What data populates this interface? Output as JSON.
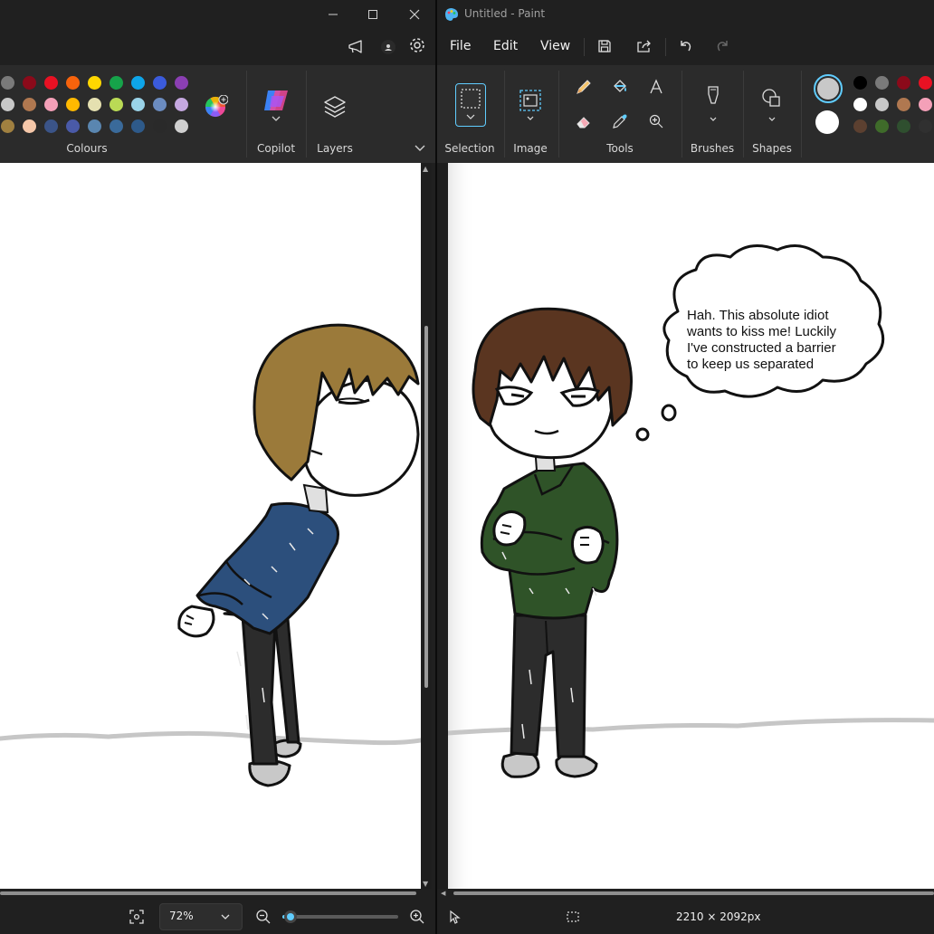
{
  "left_window": {
    "ribbon": {
      "colours_label": "Colours",
      "copilot_label": "Copilot",
      "layers_label": "Layers",
      "palette": [
        [
          "#7a7a7a",
          "#8b0a1a",
          "#e81123",
          "#f7630c",
          "#ffd700",
          "#16a34a",
          "#0ea5e9",
          "#3b5bdb",
          "#8b3fb3"
        ],
        [
          "#c8c8c8",
          "#b07850",
          "#f4a0b8",
          "#ffb900",
          "#e5e0b0",
          "#bada55",
          "#9ad3e8",
          "#6b8cc0",
          "#c5a8e0"
        ],
        [
          "#a08040",
          "#f5c7a9",
          "#3b5488",
          "#4a5aa8",
          "#5a86b0",
          "#3a6a9a",
          "#2e5a8a",
          "#2a2a2a",
          "#d0d0d0"
        ]
      ]
    },
    "statusbar": {
      "zoom": "72%",
      "zoom_fraction": 0.07
    }
  },
  "right_window": {
    "title": "Untitled - Paint",
    "menu": {
      "file": "File",
      "edit": "Edit",
      "view": "View"
    },
    "ribbon": {
      "selection_label": "Selection",
      "image_label": "Image",
      "tools_label": "Tools",
      "brushes_label": "Brushes",
      "shapes_label": "Shapes",
      "palette": [
        [
          "#000000",
          "#7a7a7a",
          "#8b0a1a",
          "#e81123"
        ],
        [
          "#ffffff",
          "#c8c8c8",
          "#b07850",
          "#f4a0b8"
        ],
        [
          "#5c4030",
          "#3f6b2a",
          "#2f4f2f",
          "#303030"
        ]
      ],
      "primary_colour": "#c8c8c8",
      "secondary_colour": "#ffffff"
    },
    "statusbar": {
      "dimensions": "2210 × 2092px"
    },
    "canvas": {
      "thought_text": [
        "Hah. This absolute idiot",
        "wants to kiss me! Luckily",
        "I've constructed a barrier",
        "to keep us separated"
      ]
    }
  },
  "colors": {
    "accent": "#60cdff",
    "hair_left": "#9b7a3a",
    "sweater_left": "#2c4f7c",
    "hair_right": "#5a3520",
    "sweater_right": "#2f5328",
    "pants": "#2c2c2c"
  }
}
